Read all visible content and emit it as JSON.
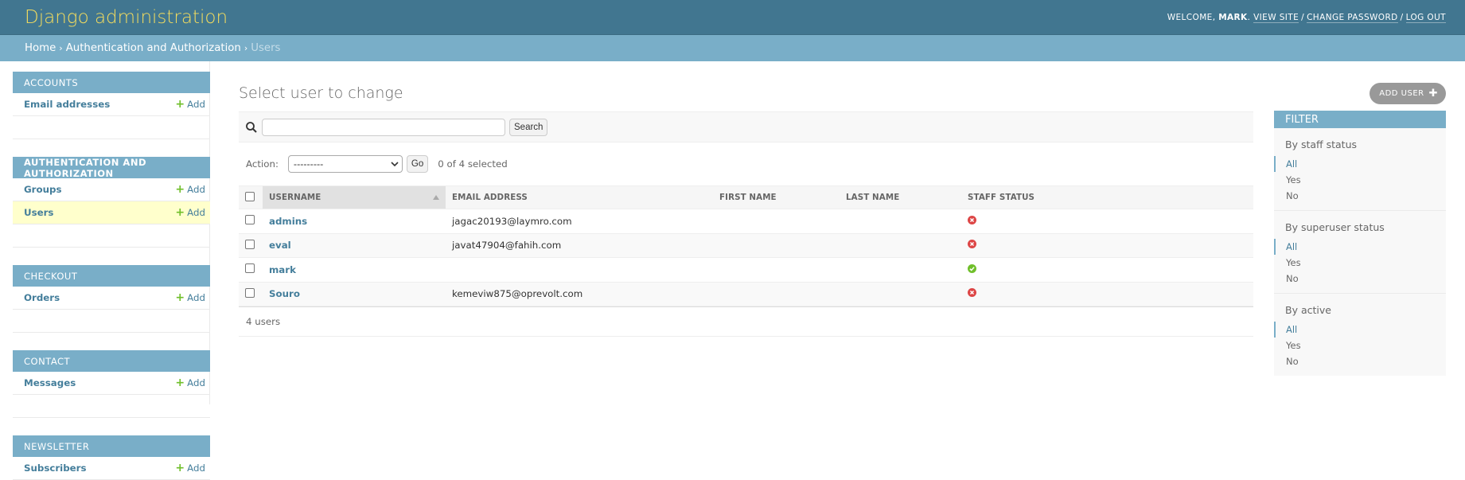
{
  "header": {
    "branding": "Django administration",
    "welcome": "WELCOME,",
    "username": "MARK",
    "view_site": "VIEW SITE",
    "change_password": "CHANGE PASSWORD",
    "log_out": "LOG OUT"
  },
  "breadcrumbs": {
    "home": "Home",
    "app": "Authentication and Authorization",
    "current": "Users"
  },
  "sidebar": {
    "add_label": "Add",
    "modules": [
      {
        "caption": "Accounts",
        "models": [
          {
            "name": "Email addresses"
          }
        ]
      },
      {
        "caption": "Authentication and Authorization",
        "models": [
          {
            "name": "Groups"
          },
          {
            "name": "Users"
          }
        ]
      },
      {
        "caption": "Checkout",
        "models": [
          {
            "name": "Orders"
          }
        ]
      },
      {
        "caption": "Contact",
        "models": [
          {
            "name": "Messages"
          }
        ]
      },
      {
        "caption": "Newsletter",
        "models": [
          {
            "name": "Subscribers"
          }
        ]
      }
    ]
  },
  "content": {
    "title": "Select user to change",
    "add_button": "ADD USER"
  },
  "search": {
    "value": "",
    "button": "Search"
  },
  "actions": {
    "label": "Action:",
    "selected_option": "---------",
    "go": "Go",
    "counter": "0 of 4 selected"
  },
  "table": {
    "columns": [
      "Username",
      "Email address",
      "First name",
      "Last name",
      "Staff status"
    ],
    "rows": [
      {
        "username": "admins",
        "email": "jagac20193@laymro.com",
        "first_name": "",
        "last_name": "",
        "staff": false
      },
      {
        "username": "eval",
        "email": "javat47904@fahih.com",
        "first_name": "",
        "last_name": "",
        "staff": false
      },
      {
        "username": "mark",
        "email": "",
        "first_name": "",
        "last_name": "",
        "staff": true
      },
      {
        "username": "Souro",
        "email": "kemeviw875@oprevolt.com",
        "first_name": "",
        "last_name": "",
        "staff": false
      }
    ],
    "footer": "4 users"
  },
  "filter": {
    "title": "Filter",
    "groups": [
      {
        "title": "By staff status",
        "options": [
          "All",
          "Yes",
          "No"
        ],
        "selected": "All"
      },
      {
        "title": "By superuser status",
        "options": [
          "All",
          "Yes",
          "No"
        ],
        "selected": "All"
      },
      {
        "title": "By active",
        "options": [
          "All",
          "Yes",
          "No"
        ],
        "selected": "All"
      }
    ]
  },
  "colors": {
    "header_bg": "#417690",
    "breadcrumbs_bg": "#79aec8",
    "branding": "#f5dd5d",
    "link": "#447e9b",
    "add_green": "#70bf2b",
    "no_red": "#dd4646",
    "yes_green": "#70bf2b",
    "current_row": "#ffffcc"
  }
}
